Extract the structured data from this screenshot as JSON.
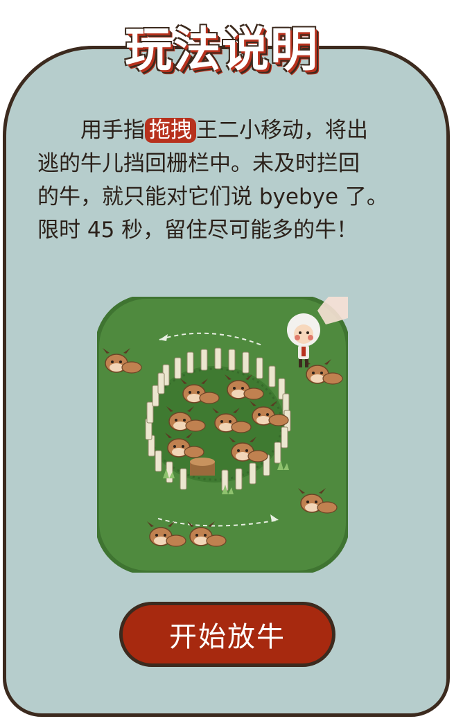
{
  "title": "玩法说明",
  "instructions": {
    "part1": "用手指",
    "highlight": "拖拽",
    "part2": "王二小移动，将出",
    "line2": "逃的牛儿挡回栅栏中。未及时拦回",
    "line3": "的牛，就只能对它们说 byebye 了。",
    "line4": "限时 45 秒，留住尽可能多的牛！"
  },
  "start_button": {
    "label": "开始放牛"
  },
  "colors": {
    "card": "#b6cdcc",
    "accent": "#b7311d",
    "grass": "#4f8a3e",
    "border": "#3c2a1e"
  }
}
